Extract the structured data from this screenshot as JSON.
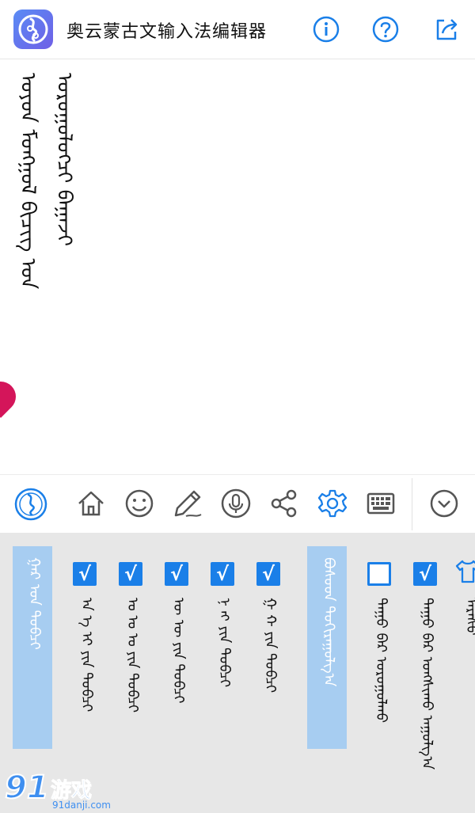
{
  "app": {
    "title": "奥云蒙古文输入法编辑器",
    "icon": "app-logo-icon",
    "accent": "#1a7fe8"
  },
  "header_buttons": [
    {
      "icon": "info-icon"
    },
    {
      "icon": "help-icon"
    },
    {
      "icon": "share-export-icon"
    }
  ],
  "editor": {
    "text": "ᠣᠶᠤᠨ ᠮᠣᠩᠭᠣᠯ ᠪᠢᠴᠢᠭ ᠤᠨ ᠣᠷᠣᠭᠤᠯᠤᠭ᠌ᠴᠢ ᠪᠠᠭᠠᠵᠢ",
    "cursor_color": "#d4155a"
  },
  "toolbar": [
    {
      "icon": "app-logo-icon"
    },
    {
      "icon": "home-icon"
    },
    {
      "icon": "emoji-icon"
    },
    {
      "icon": "pencil-icon"
    },
    {
      "icon": "microphone-icon"
    },
    {
      "icon": "share-icon"
    },
    {
      "icon": "gear-icon"
    },
    {
      "icon": "keyboard-icon"
    },
    {
      "icon": "chevron-down-icon"
    }
  ],
  "panel": {
    "background": "#e7e7e7",
    "header_color": "#a7cdf1",
    "group1_title": "ᠭᠠᠷ ᠤᠨ ᠲᠣᠪᠴᠢ",
    "group1_options": [
      {
        "checked": true,
        "mark": "√",
        "label": "ᠠ ᠡ ᠢ ᠶᠢᠨ ᠲᠣᠪᠴᠢ"
      },
      {
        "checked": true,
        "mark": "√",
        "label": "ᠣ ᠣ ᠤ ᠶᠢᠨ ᠲᠣᠪᠴᠢ"
      },
      {
        "checked": true,
        "mark": "√",
        "label": "ᠥ ᠦ ᠶᠢᠨ ᠲᠣᠪᠴᠢ"
      },
      {
        "checked": true,
        "mark": "√",
        "label": "ᠨ ᠩ ᠶᠢᠨ ᠲᠣᠪᠴᠢ"
      },
      {
        "checked": true,
        "mark": "√",
        "label": "ᠭ ᠬ ᠶᠢᠨ ᠲᠣᠪᠴᠢ"
      }
    ],
    "group2_title": "ᠪᠤᠰᠤᠳ ᠲᠣᠬᠢᠷᠠᠭᠤᠯᠭ᠎ᠠ",
    "group2_options": [
      {
        "checked": false,
        "mark": "",
        "label": "ᠳᠠᠭᠤ ᠪᠠᠷ ᠣᠷᠣᠭᠤᠯᠬᠤ"
      },
      {
        "checked": true,
        "mark": "√",
        "label": "ᠳᠠᠭᠤ ᠪᠠᠷ ᠤᠩᠰᠢᠬᠤ ᠠᠭᠤᠯᠭ᠎ᠠ"
      }
    ],
    "group3_label": "ᠠᠷᠠᠰᠤ"
  },
  "watermark": {
    "number": "91",
    "brand": "游戏",
    "url": "91danji.com"
  }
}
